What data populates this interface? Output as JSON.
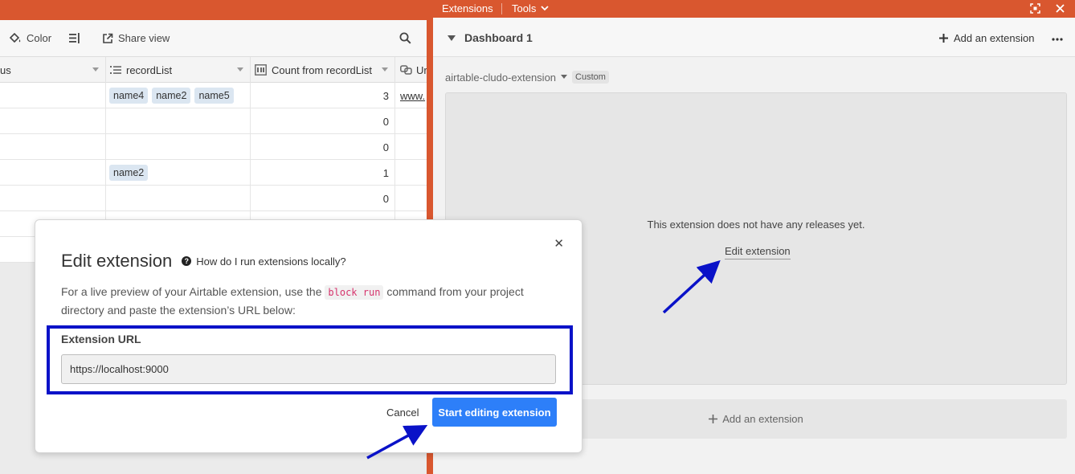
{
  "toolbar": {
    "color_label": "Color",
    "share_view_label": "Share view"
  },
  "grid": {
    "headers": {
      "status_partial": "us",
      "record_list": "recordList",
      "count": "Count from recordList",
      "url_partial": "Ur"
    },
    "rows": [
      {
        "chips": [
          "name4",
          "name2",
          "name5"
        ],
        "count": "3",
        "url": "www."
      },
      {
        "chips": [],
        "count": "0",
        "url": ""
      },
      {
        "chips": [],
        "count": "0",
        "url": ""
      },
      {
        "chips": [
          "name2"
        ],
        "count": "1",
        "url": ""
      },
      {
        "chips": [],
        "count": "0",
        "url": ""
      },
      {
        "chips": [],
        "count": "",
        "url": ""
      },
      {
        "chips": [],
        "count": "",
        "url": ""
      }
    ]
  },
  "extensions_panel": {
    "tab_extensions": "Extensions",
    "tab_tools": "Tools",
    "dashboard_title": "Dashboard 1",
    "add_extension_header": "Add an extension",
    "extension_name": "airtable-cludo-extension",
    "badge": "Custom",
    "no_releases": "This extension does not have any releases yet.",
    "edit_extension_link": "Edit extension",
    "add_extension_bottom": "Add an extension"
  },
  "modal": {
    "title": "Edit extension",
    "help_text": "How do I run extensions locally?",
    "desc_part1": "For a live preview of your Airtable extension, use the ",
    "desc_code": "block run",
    "desc_part2": " command from your project directory and paste the extension’s URL below:",
    "url_label": "Extension URL",
    "url_value": "https://localhost:9000",
    "cancel_label": "Cancel",
    "start_label": "Start editing extension"
  },
  "colors": {
    "brand_orange": "#d9572f",
    "primary_blue": "#2d7ff9",
    "annotation_blue": "#0a12c8",
    "chip_bg": "#dbe6f1"
  }
}
